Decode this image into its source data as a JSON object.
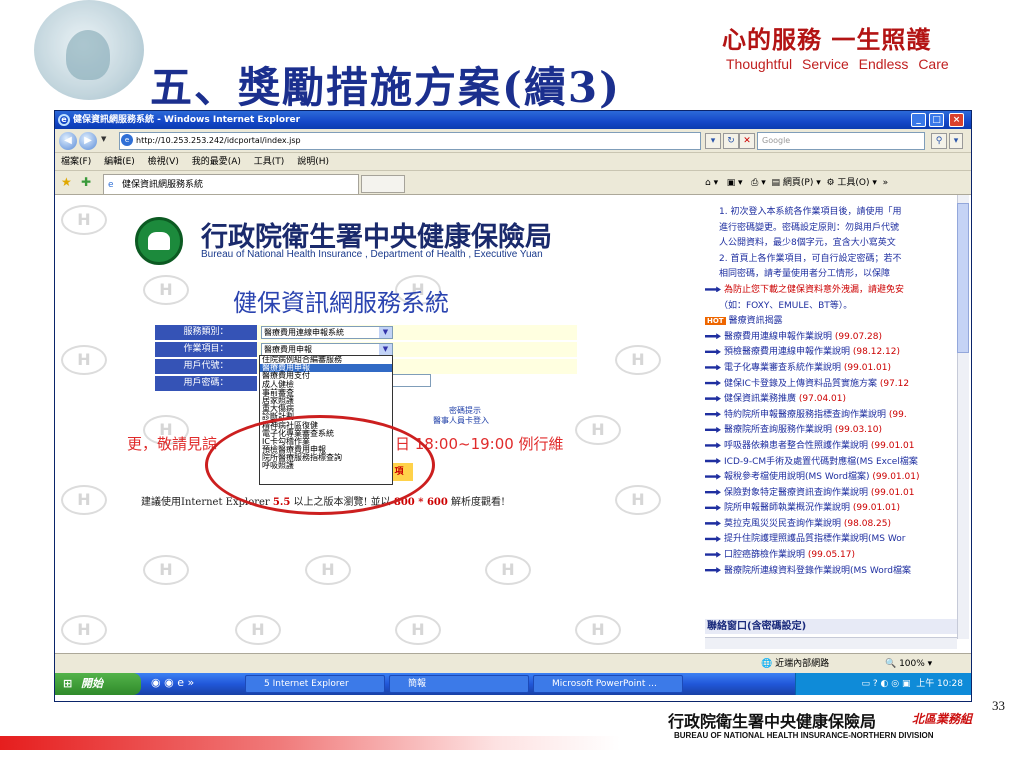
{
  "slide": {
    "title": "五、獎勵措施方案(續3)",
    "slogan_cn": "心的服務 一生照護",
    "slogan_en": "Thoughtful Service Endless Care",
    "page_number": "33",
    "footer_cn": "行政院衛生署中央健康保險局",
    "footer_division": "北區業務組",
    "footer_en": "BUREAU OF NATIONAL HEALTH INSURANCE-NORTHERN DIVISION"
  },
  "window": {
    "title": "健保資訊網服務系統 - Windows Internet Explorer",
    "url": "http://10.253.253.242/idcportal/index.jsp",
    "search_placeholder": "Google",
    "menu": [
      "檔案(F)",
      "編輯(E)",
      "檢視(V)",
      "我的最愛(A)",
      "工具(T)",
      "說明(H)"
    ],
    "tab_title": "健保資訊網服務系統",
    "toolbar": {
      "page": "網頁(P)",
      "tools": "工具(O)"
    }
  },
  "page": {
    "org_name": "行政院衛生署中央健康保險局",
    "org_en": "Bureau of National Health Insurance , Department of Health , Executive Yuan",
    "system_title": "健保資訊網服務系統",
    "form": {
      "service_label": "服務類別：",
      "service_value": "醫療費用連線申報系統",
      "item_label": "作業項目：",
      "item_value": "醫療費用申報",
      "user_label": "用戶代號：",
      "password_label": "用戶密碼：",
      "dropdown_options": [
        "住院病例組合編審服務",
        "醫療費用申報",
        "醫療費用支付",
        "成人健檢",
        "事前審查",
        "居家照護",
        "重大傷病",
        "診斷計劃",
        "精神病社區復健",
        "電子化專業審查系統",
        "IC卡勾稽作業",
        "預檢醫療費用申報",
        "院所醫療服務指標查詢",
        "呼吸照護"
      ],
      "hint1": "密碼提示",
      "hint2": "醫事人員卡登入",
      "login": "項"
    },
    "notice_left": "更，敬請見諒",
    "notice_right": "日 18:00~19:00 例行維",
    "recommend": {
      "prefix": "建議使用Internet Explorer",
      "ver": "5.5",
      "mid": "以上之版本瀏覽! 並以",
      "res": "800 * 600",
      "suffix": "解析度觀看!"
    },
    "news": {
      "intro": [
        {
          "text": "1. 初次登入本系統各作業項目後，請使用「用"
        },
        {
          "text": "進行密碼變更。密碼設定原則：勿與用戶代號"
        },
        {
          "text": "人公開資料，最少8個字元，宜含大小寫英文"
        },
        {
          "text": "2. 首頁上各作業項目，可自行設定密碼；若不"
        },
        {
          "text": "相同密碼，請考量使用者分工情形，以保障"
        }
      ],
      "warn": {
        "text": "為防止您下載之健保資料意外洩漏，請避免安",
        "cont": "（如：FOXY、EMULE、BT等）。"
      },
      "hot": {
        "badge": "HOT",
        "text": "醫療資訊揭露"
      },
      "items": [
        {
          "text": "醫療費用連線申報作業說明",
          "date": "(99.07.28)"
        },
        {
          "text": "預檢醫療費用連線申報作業說明",
          "date": "(98.12.12)"
        },
        {
          "text": "電子化專業審查系統作業說明",
          "date": "(99.01.01)"
        },
        {
          "text": "健保IC卡登錄及上傳資料品質實施方案",
          "date": "(97.12"
        },
        {
          "text": "健保資訊業務推廣",
          "date": "(97.04.01)"
        },
        {
          "text": "特約院所申報醫療服務指標查詢作業說明",
          "date": "(99."
        },
        {
          "text": "醫療院所查詢服務作業說明",
          "date": "(99.03.10)"
        },
        {
          "text": "呼吸器依賴患者整合性照護作業說明",
          "date": "(99.01.01"
        },
        {
          "text": "ICD-9-CM手術及處置代碼對應檔(MS Excel檔案",
          "date": ""
        },
        {
          "text": "報稅參考檔使用說明(MS Word檔案)",
          "date": "(99.01.01)"
        },
        {
          "text": "保險對象特定醫療資訊查詢作業說明",
          "date": "(99.01.01"
        },
        {
          "text": "院所申報醫師執業概況作業說明",
          "date": "(99.01.01)"
        },
        {
          "text": "莫拉克風災災民查詢作業說明",
          "date": "(98.08.25)"
        },
        {
          "text": "提升住院護理照護品質指標作業說明(MS Wor",
          "date": ""
        },
        {
          "text": "口腔癌篩檢作業說明",
          "date": "(99.05.17)"
        },
        {
          "text": "醫療院所連線資料登錄作業說明(MS Word檔案",
          "date": ""
        }
      ],
      "contact": "聯絡窗口(含密碼設定)"
    }
  },
  "status": {
    "zone": "近端內部網路",
    "zoom": "100%"
  },
  "taskbar": {
    "start": "開始",
    "tasks": [
      "5 Internet Explorer",
      "簡報",
      "Microsoft PowerPoint ..."
    ],
    "clock": "上午 10:28"
  }
}
